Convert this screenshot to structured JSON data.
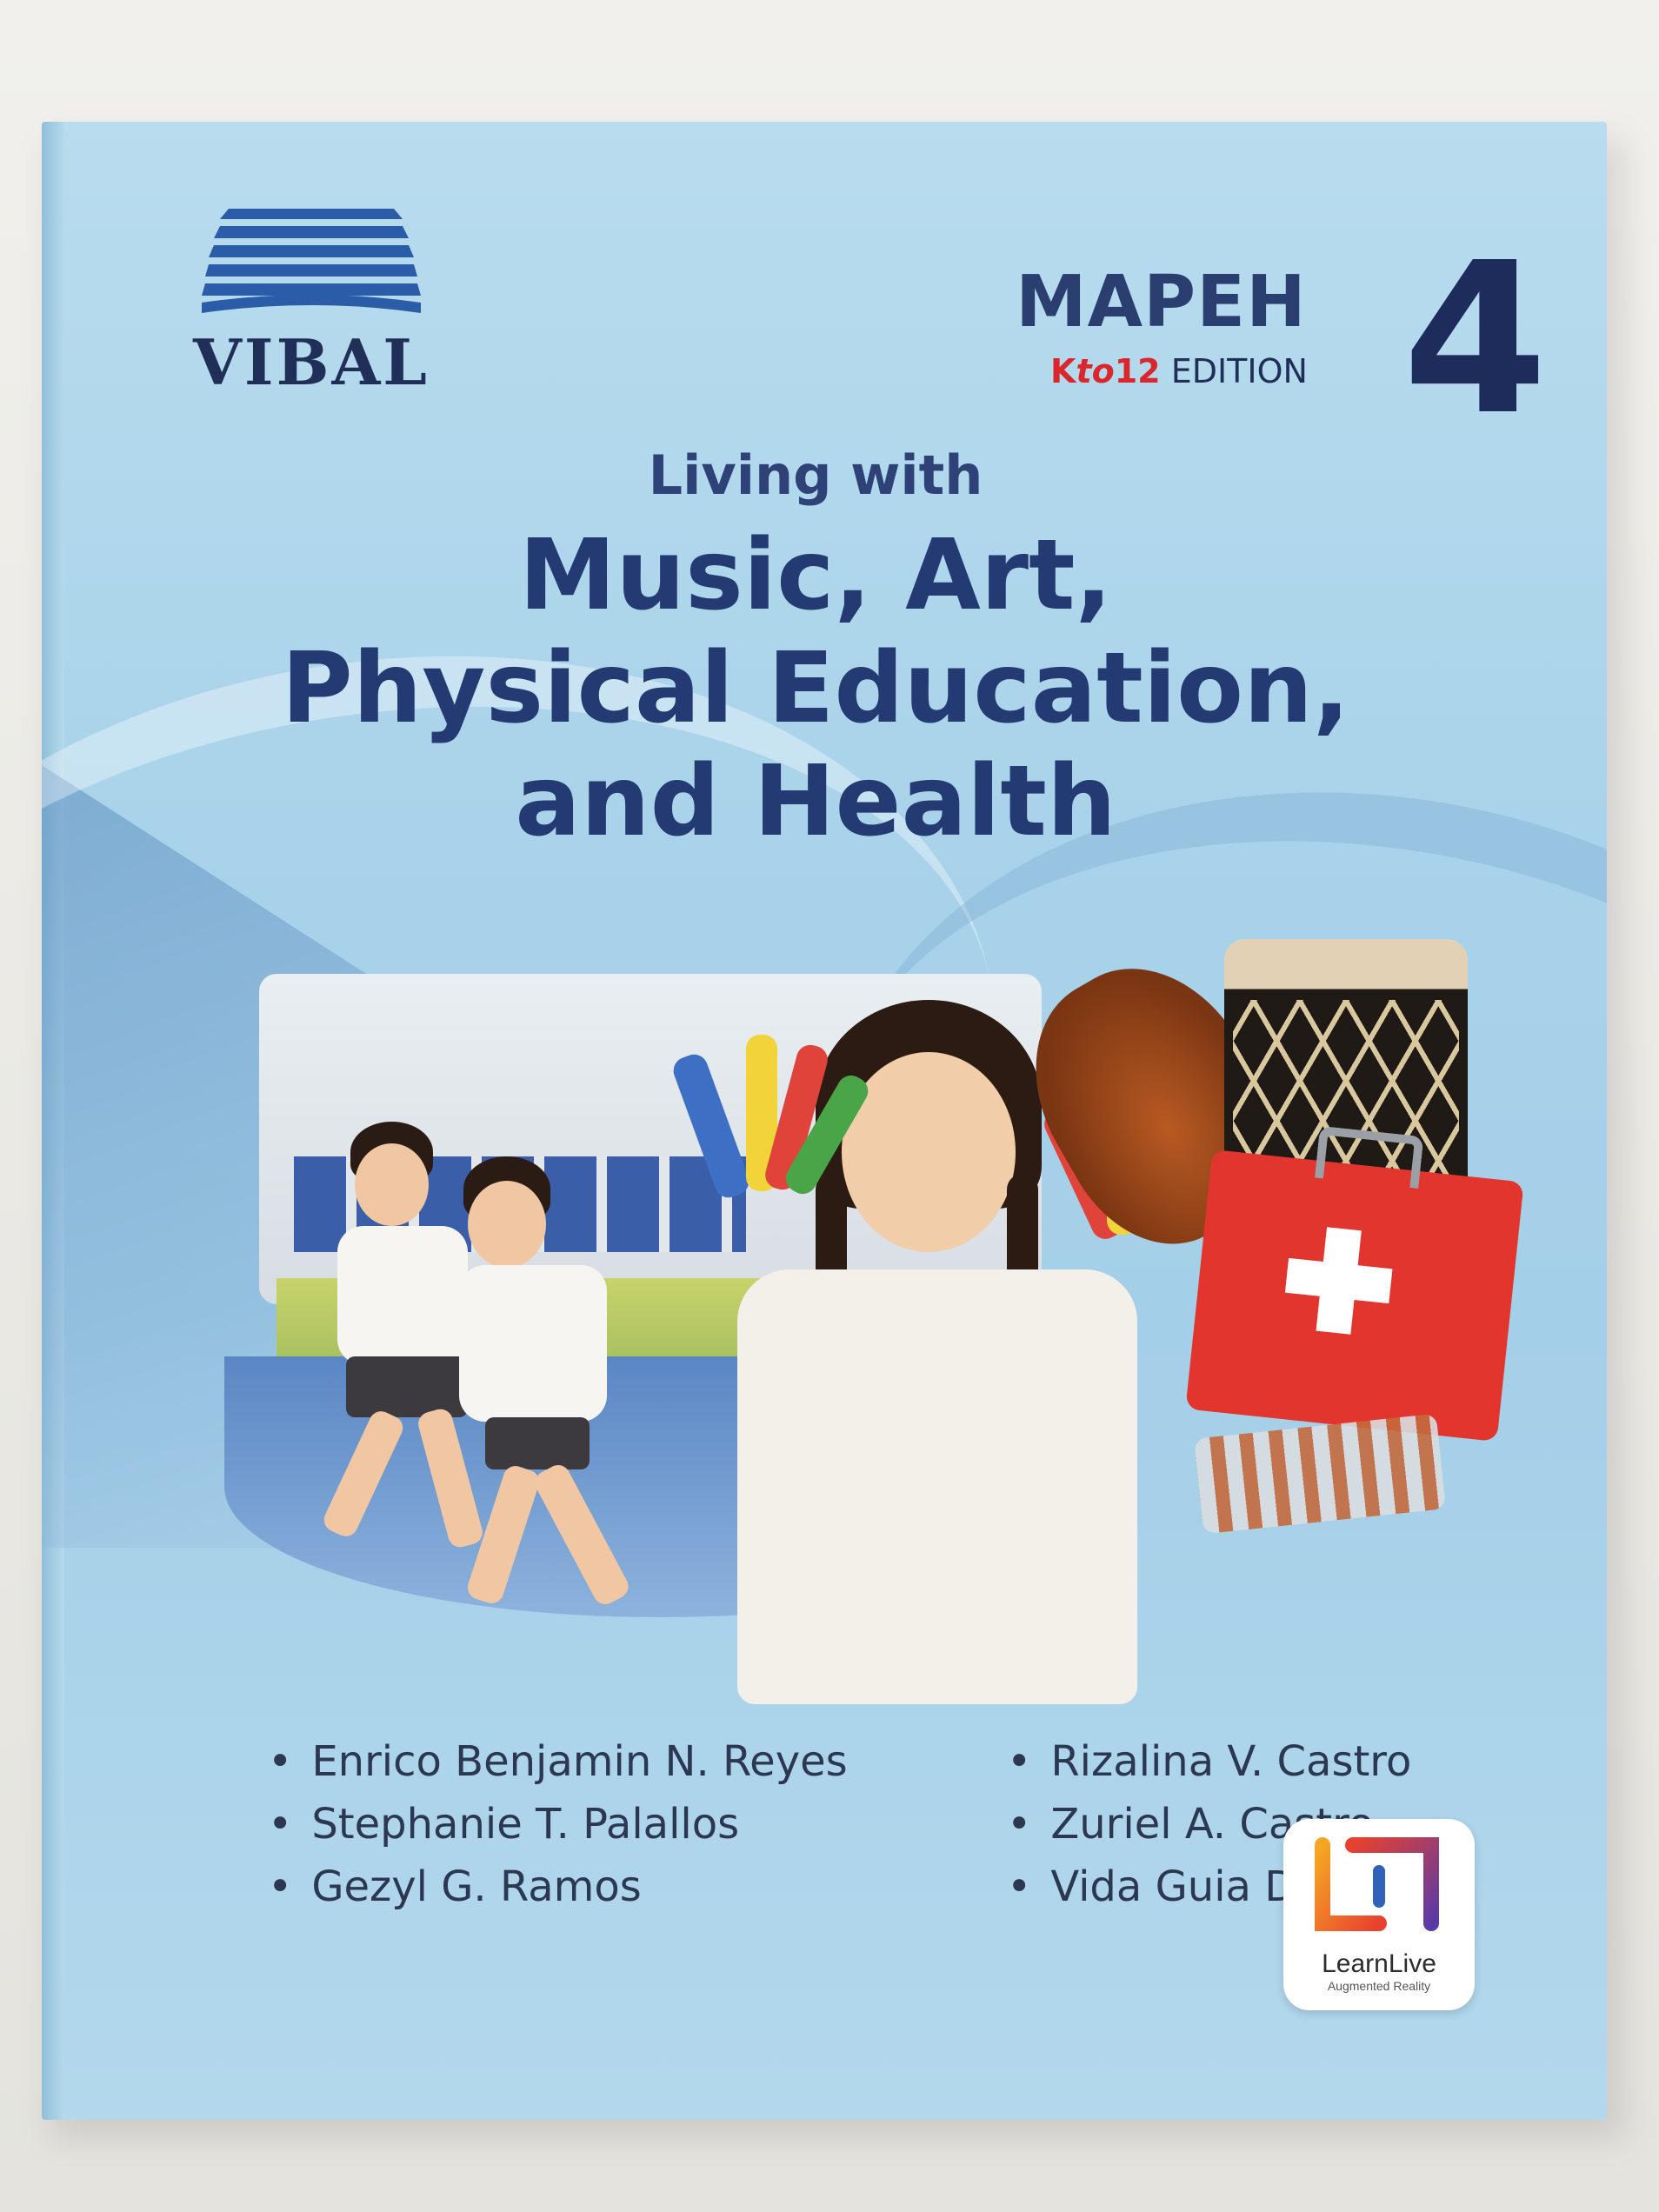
{
  "cover": {
    "publisher": "VIBAL",
    "series": "MAPEH",
    "edition": {
      "k": "K",
      "to": "to",
      "number": "12",
      "rest": " EDITION"
    },
    "grade": "4",
    "title_pre": "Living with",
    "title_lines": [
      "Music, Art,",
      "Physical Education,",
      "and Health"
    ],
    "authors_left": [
      "Enrico Benjamin N. Reyes",
      "Stephanie T. Palallos",
      "Gezyl G. Ramos"
    ],
    "authors_right": [
      "Rizalina V. Castro",
      "Zuriel A. Castro",
      "Vida Guia D. Vergel"
    ],
    "badge": {
      "name": "LearnLive",
      "subtitle": "Augmented Reality"
    },
    "colors": {
      "title": "#233a72",
      "accent_red": "#d9272d",
      "cover_blue": "#a9d3ea"
    }
  }
}
